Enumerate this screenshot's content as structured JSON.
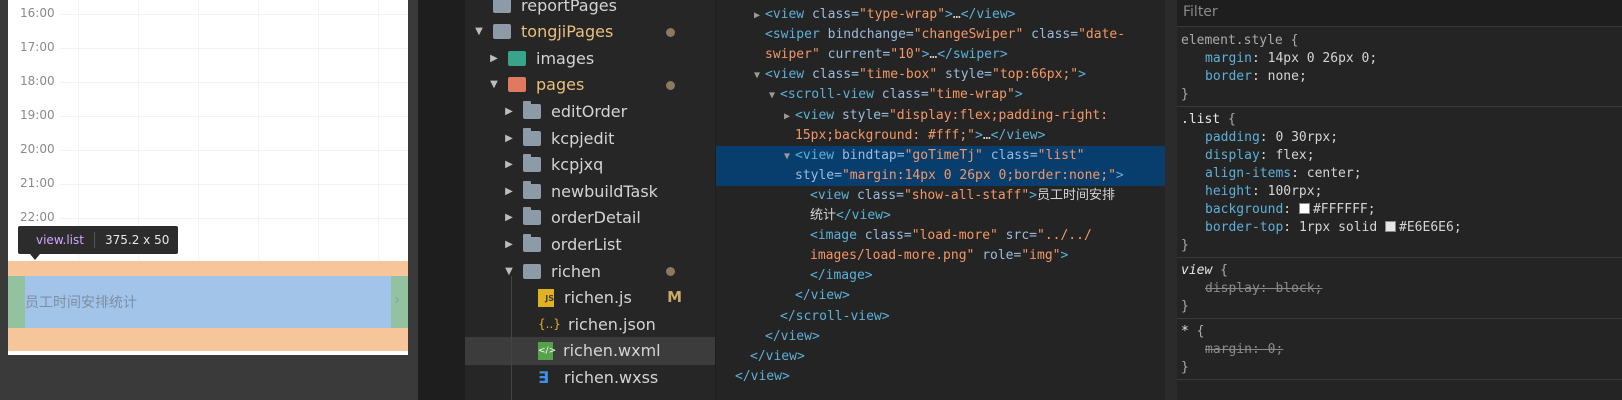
{
  "simulator": {
    "hours": [
      "16:00",
      "17:00",
      "18:00",
      "19:00",
      "20:00",
      "21:00",
      "22:00"
    ],
    "tooltip": {
      "tag": "view.list",
      "dims": "375.2 x 50"
    },
    "list_label": "员工时间安排统计",
    "arrow": "›"
  },
  "tree": {
    "items": [
      {
        "label": "reportPages",
        "depth": 1,
        "icon": "folder-icon",
        "caret": "",
        "state": ""
      },
      {
        "label": "tongjiPages",
        "depth": 1,
        "icon": "folder-open-icon",
        "caret": "▼",
        "state": "dot"
      },
      {
        "label": "images",
        "depth": 2,
        "icon": "image-folder-icon",
        "caret": "▶",
        "state": ""
      },
      {
        "label": "pages",
        "depth": 2,
        "icon": "pages-folder-icon",
        "caret": "▼",
        "state": "dot"
      },
      {
        "label": "editOrder",
        "depth": 3,
        "icon": "folder-icon",
        "caret": "▶",
        "state": ""
      },
      {
        "label": "kcpjedit",
        "depth": 3,
        "icon": "folder-icon",
        "caret": "▶",
        "state": ""
      },
      {
        "label": "kcpjxq",
        "depth": 3,
        "icon": "folder-icon",
        "caret": "▶",
        "state": ""
      },
      {
        "label": "newbuildTask",
        "depth": 3,
        "icon": "folder-icon",
        "caret": "▶",
        "state": ""
      },
      {
        "label": "orderDetail",
        "depth": 3,
        "icon": "folder-icon",
        "caret": "▶",
        "state": ""
      },
      {
        "label": "orderList",
        "depth": 3,
        "icon": "folder-icon",
        "caret": "▶",
        "state": ""
      },
      {
        "label": "richen",
        "depth": 3,
        "icon": "folder-open-icon",
        "caret": "▼",
        "state": "dot"
      },
      {
        "label": "richen.js",
        "depth": 4,
        "icon": "js-file-icon",
        "caret": "",
        "state": "M"
      },
      {
        "label": "richen.json",
        "depth": 4,
        "icon": "json-file-icon",
        "caret": "",
        "state": ""
      },
      {
        "label": "richen.wxml",
        "depth": 4,
        "icon": "wxml-file-icon",
        "caret": "",
        "state": "selected"
      },
      {
        "label": "richen.wxss",
        "depth": 4,
        "icon": "wxss-file-icon",
        "caret": "",
        "state": ""
      }
    ],
    "icon_glyphs": {
      "js": "JS",
      "json": "{..}",
      "wxml": "</>",
      "wxss": "∃"
    },
    "modified_badge": "M"
  },
  "elements": {
    "ellipsis": "...",
    "lines": [
      {
        "indent": 3,
        "tri": "▶",
        "parts": [
          [
            "tag",
            "<view "
          ],
          [
            "attr",
            "class="
          ],
          [
            "val",
            "\"type-wrap\""
          ],
          [
            "tag",
            ">"
          ],
          [
            "txt",
            "…"
          ],
          [
            "tag",
            "</view>"
          ]
        ]
      },
      {
        "indent": 3,
        "tri": "",
        "parts": [
          [
            "tag",
            "<swiper "
          ],
          [
            "attr",
            "bindchange="
          ],
          [
            "val",
            "\"changeSwiper\""
          ],
          [
            "attr",
            " class="
          ],
          [
            "val",
            "\"date-"
          ]
        ]
      },
      {
        "indent": 3,
        "tri": "",
        "parts": [
          [
            "val",
            "swiper\""
          ],
          [
            "attr",
            " current="
          ],
          [
            "val",
            "\"10\""
          ],
          [
            "tag",
            ">"
          ],
          [
            "txt",
            "…"
          ],
          [
            "tag",
            "</swiper>"
          ]
        ]
      },
      {
        "indent": 3,
        "tri": "▼",
        "parts": [
          [
            "tag",
            "<view "
          ],
          [
            "attr",
            "class="
          ],
          [
            "val",
            "\"time-box\""
          ],
          [
            "attr",
            " style="
          ],
          [
            "val",
            "\"top:66px;\""
          ],
          [
            "tag",
            ">"
          ]
        ]
      },
      {
        "indent": 4,
        "tri": "▼",
        "parts": [
          [
            "tag",
            "<scroll-view "
          ],
          [
            "attr",
            "class="
          ],
          [
            "val",
            "\"time-wrap\""
          ],
          [
            "tag",
            ">"
          ]
        ]
      },
      {
        "indent": 5,
        "tri": "▶",
        "parts": [
          [
            "tag",
            "<view "
          ],
          [
            "attr",
            "style="
          ],
          [
            "val",
            "\"display:flex;padding-right:"
          ]
        ]
      },
      {
        "indent": 5,
        "tri": "",
        "parts": [
          [
            "val",
            "15px;background: #fff;\""
          ],
          [
            "tag",
            ">"
          ],
          [
            "txt",
            "…"
          ],
          [
            "tag",
            "</view>"
          ]
        ]
      },
      {
        "indent": 5,
        "tri": "▼",
        "parts": [
          [
            "tag",
            "<view "
          ],
          [
            "attr",
            "bindtap="
          ],
          [
            "val",
            "\"goTimeTj\""
          ],
          [
            "attr",
            " class="
          ],
          [
            "val",
            "\"list\""
          ]
        ]
      },
      {
        "indent": 5,
        "tri": "",
        "parts": [
          [
            "attr",
            "style="
          ],
          [
            "val",
            "\"margin:14px 0 26px 0;border:none;\""
          ],
          [
            "tag",
            ">"
          ]
        ]
      },
      {
        "indent": 6,
        "tri": "",
        "parts": [
          [
            "tag",
            "<view "
          ],
          [
            "attr",
            "class="
          ],
          [
            "val",
            "\"show-all-staff\""
          ],
          [
            "tag",
            ">"
          ],
          [
            "txt",
            "员工时间安排"
          ]
        ]
      },
      {
        "indent": 6,
        "tri": "",
        "parts": [
          [
            "txt",
            "统计"
          ],
          [
            "tag",
            "</view>"
          ]
        ]
      },
      {
        "indent": 6,
        "tri": "",
        "parts": [
          [
            "tag",
            "<image "
          ],
          [
            "attr",
            "class="
          ],
          [
            "val",
            "\"load-more\""
          ],
          [
            "attr",
            " src="
          ],
          [
            "val",
            "\"../../"
          ]
        ]
      },
      {
        "indent": 6,
        "tri": "",
        "parts": [
          [
            "val",
            "images/load-more.png\""
          ],
          [
            "attr",
            " role="
          ],
          [
            "val",
            "\"img\""
          ],
          [
            "tag",
            ">"
          ]
        ]
      },
      {
        "indent": 6,
        "tri": "",
        "parts": [
          [
            "tag",
            "</image>"
          ]
        ]
      },
      {
        "indent": 5,
        "tri": "",
        "parts": [
          [
            "tag",
            "</view>"
          ]
        ]
      },
      {
        "indent": 4,
        "tri": "",
        "parts": [
          [
            "tag",
            "</scroll-view>"
          ]
        ]
      },
      {
        "indent": 3,
        "tri": "",
        "parts": [
          [
            "tag",
            "</view>"
          ]
        ]
      },
      {
        "indent": 2,
        "tri": "",
        "parts": [
          [
            "tag",
            "</view>"
          ]
        ]
      },
      {
        "indent": 1,
        "tri": "",
        "parts": [
          [
            "tag",
            "</view>"
          ]
        ]
      }
    ]
  },
  "styles": {
    "filter_placeholder": "Filter",
    "rules": [
      {
        "selector": "element.style",
        "muted": true,
        "italic": false,
        "props": [
          {
            "name": "margin",
            "value": "14px 0 26px 0",
            "strike": false
          },
          {
            "name": "border",
            "value": "none",
            "strike": false
          }
        ]
      },
      {
        "selector": ".list",
        "muted": false,
        "italic": false,
        "props": [
          {
            "name": "padding",
            "value": "0 30rpx",
            "strike": false
          },
          {
            "name": "display",
            "value": "flex",
            "strike": false
          },
          {
            "name": "align-items",
            "value": "center",
            "strike": false
          },
          {
            "name": "height",
            "value": "100rpx",
            "strike": false
          },
          {
            "name": "background",
            "value": "#FFFFFF",
            "strike": false,
            "swatch": "#FFFFFF"
          },
          {
            "name": "border-top",
            "value": "1rpx solid #E6E6E6",
            "strike": false,
            "swatch": "#E6E6E6",
            "swatch_prefix": "1rpx solid "
          }
        ]
      },
      {
        "selector": "view",
        "muted": false,
        "italic": true,
        "props": [
          {
            "name": "display",
            "value": "block",
            "strike": true
          }
        ]
      },
      {
        "selector": "*",
        "muted": false,
        "italic": false,
        "props": [
          {
            "name": "margin",
            "value": "0",
            "strike": true
          }
        ]
      }
    ]
  }
}
